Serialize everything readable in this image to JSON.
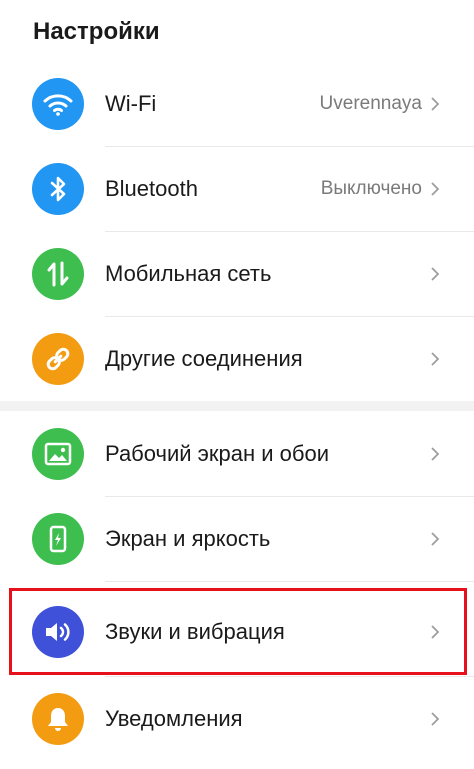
{
  "header": {
    "title": "Настройки"
  },
  "colors": {
    "wifi": "#2196f3",
    "bluetooth": "#2196f3",
    "mobile": "#3dbe4f",
    "other_connections": "#f39c12",
    "home_screen": "#3dbe4f",
    "display": "#3dbe4f",
    "sounds": "#3f51d8",
    "notifications": "#f39c12",
    "highlight": "#e8101a"
  },
  "settings": {
    "wifi": {
      "label": "Wi-Fi",
      "value": "Uverennaya",
      "icon": "wifi-icon"
    },
    "bluetooth": {
      "label": "Bluetooth",
      "value": "Выключено",
      "icon": "bluetooth-icon"
    },
    "mobile": {
      "label": "Мобильная сеть",
      "icon": "mobile-data-icon"
    },
    "other_connections": {
      "label": "Другие соединения",
      "icon": "link-icon"
    },
    "home_screen": {
      "label": "Рабочий экран и обои",
      "icon": "wallpaper-icon"
    },
    "display": {
      "label": "Экран и яркость",
      "icon": "display-brightness-icon"
    },
    "sounds": {
      "label": "Звуки и вибрация",
      "icon": "speaker-icon"
    },
    "notifications": {
      "label": "Уведомления",
      "icon": "bell-icon"
    }
  }
}
